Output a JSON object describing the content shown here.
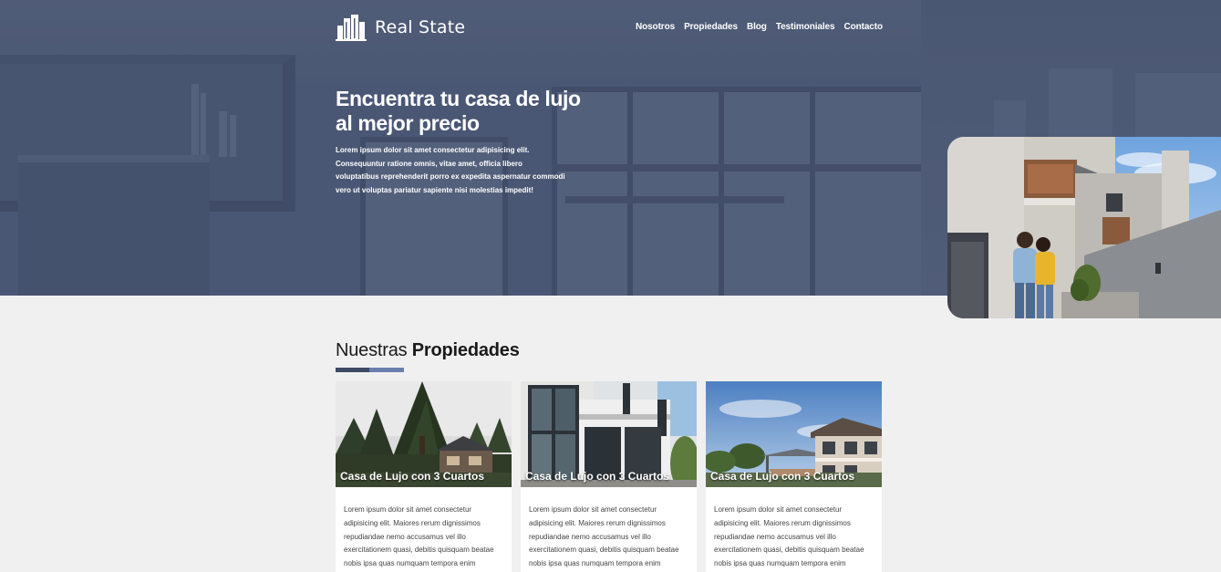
{
  "header": {
    "logo_text": "Real State",
    "nav": [
      {
        "label": "Nosotros"
      },
      {
        "label": "Propiedades"
      },
      {
        "label": "Blog"
      },
      {
        "label": "Testimoniales"
      },
      {
        "label": "Contacto"
      }
    ]
  },
  "hero": {
    "title": "Encuentra tu casa de lujo al mejor precio",
    "text": "Lorem ipsum dolor sit amet consectetur adipisicing elit. Consequuntur ratione omnis, vitae amet, officia libero voluptatibus reprehenderit porro ex expedita aspernatur commodi vero ut voluptas pariatur sapiente nisi molestias impedit!"
  },
  "properties": {
    "title_light": "Nuestras",
    "title_bold": "Propiedades",
    "accent_colors": [
      "#3d4a66",
      "#6a7fae"
    ],
    "cards": [
      {
        "caption": "Casa de Lujo con 3 Cuartos",
        "text": "Lorem ipsum dolor sit amet consectetur adipisicing elit. Maiores rerum dignissimos repudiandae nemo accusamus vel illo exercitationem quasi, debitis quisquam beatae nobis ipsa quas numquam tempora enim"
      },
      {
        "caption": "Casa de Lujo con 3 Cuartos",
        "text": "Lorem ipsum dolor sit amet consectetur adipisicing elit. Maiores rerum dignissimos repudiandae nemo accusamus vel illo exercitationem quasi, debitis quisquam beatae nobis ipsa quas numquam tempora enim"
      },
      {
        "caption": "Casa de Lujo con 3 Cuartos",
        "text": "Lorem ipsum dolor sit amet consectetur adipisicing elit. Maiores rerum dignissimos repudiandae nemo accusamus vel illo exercitationem quasi, debitis quisquam beatae nobis ipsa quas numquam tempora enim"
      }
    ]
  }
}
